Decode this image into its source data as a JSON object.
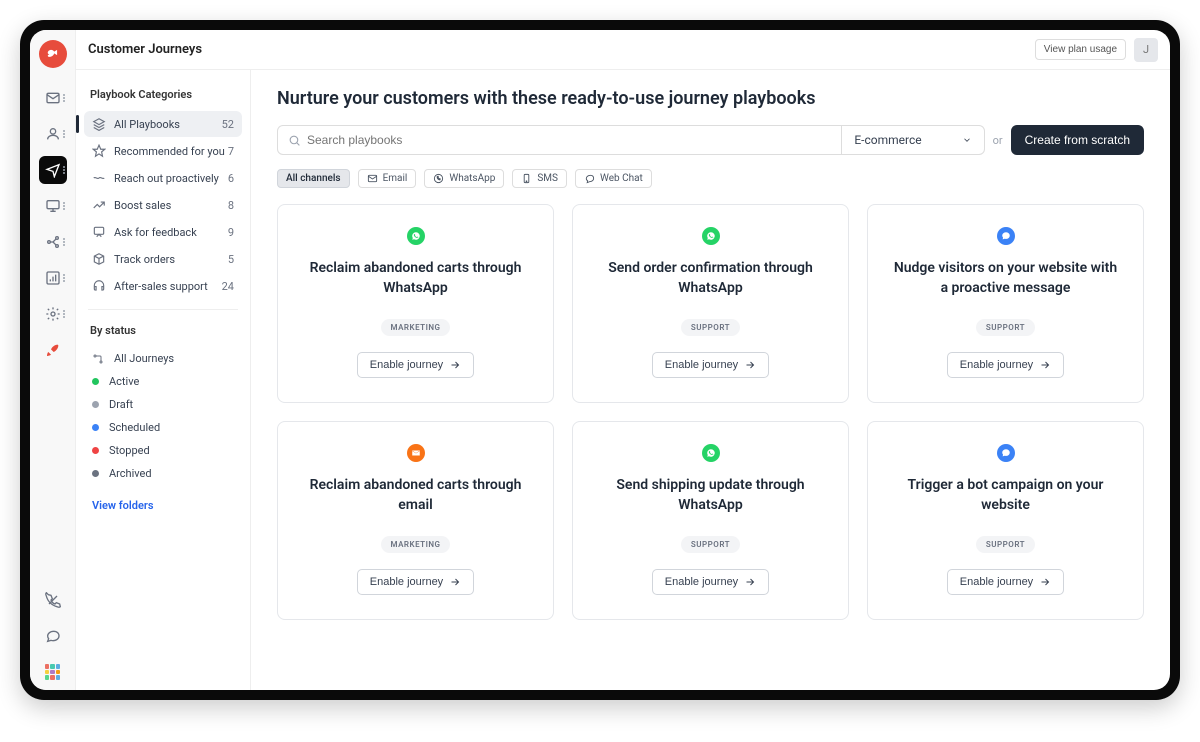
{
  "header": {
    "page_title": "Customer Journeys",
    "plan_button": "View plan usage",
    "avatar_initial": "J"
  },
  "sidebar": {
    "categories_heading": "Playbook Categories",
    "status_heading": "By status",
    "categories": [
      {
        "label": "All Playbooks",
        "count": "52"
      },
      {
        "label": "Recommended for you",
        "count": "7"
      },
      {
        "label": "Reach out proactively",
        "count": "6"
      },
      {
        "label": "Boost sales",
        "count": "8"
      },
      {
        "label": "Ask for feedback",
        "count": "9"
      },
      {
        "label": "Track orders",
        "count": "5"
      },
      {
        "label": "After-sales support",
        "count": "24"
      }
    ],
    "statuses": [
      {
        "label": "All Journeys",
        "color": ""
      },
      {
        "label": "Active",
        "color": "#22c55e"
      },
      {
        "label": "Draft",
        "color": "#9ca3af"
      },
      {
        "label": "Scheduled",
        "color": "#3b82f6"
      },
      {
        "label": "Stopped",
        "color": "#ef4444"
      },
      {
        "label": "Archived",
        "color": "#6b7280"
      }
    ],
    "folders_link": "View folders"
  },
  "content": {
    "headline": "Nurture your customers with these ready-to-use journey playbooks",
    "search_placeholder": "Search playbooks",
    "dropdown_selected": "E-commerce",
    "or_text": "or",
    "create_button": "Create from scratch",
    "channels": [
      {
        "label": "All channels"
      },
      {
        "label": "Email"
      },
      {
        "label": "WhatsApp"
      },
      {
        "label": "SMS"
      },
      {
        "label": "Web Chat"
      }
    ],
    "enable_label": "Enable journey",
    "cards": [
      {
        "icon": "whatsapp",
        "title": "Reclaim abandoned carts through WhatsApp",
        "tag": "MARKETING"
      },
      {
        "icon": "whatsapp",
        "title": "Send order confirmation through WhatsApp",
        "tag": "SUPPORT"
      },
      {
        "icon": "chat",
        "title": "Nudge visitors on your website with a proactive message",
        "tag": "SUPPORT"
      },
      {
        "icon": "email",
        "title": "Reclaim abandoned carts through email",
        "tag": "MARKETING"
      },
      {
        "icon": "whatsapp",
        "title": "Send shipping update through WhatsApp",
        "tag": "SUPPORT"
      },
      {
        "icon": "chat",
        "title": "Trigger a bot campaign on your website",
        "tag": "SUPPORT"
      }
    ]
  }
}
